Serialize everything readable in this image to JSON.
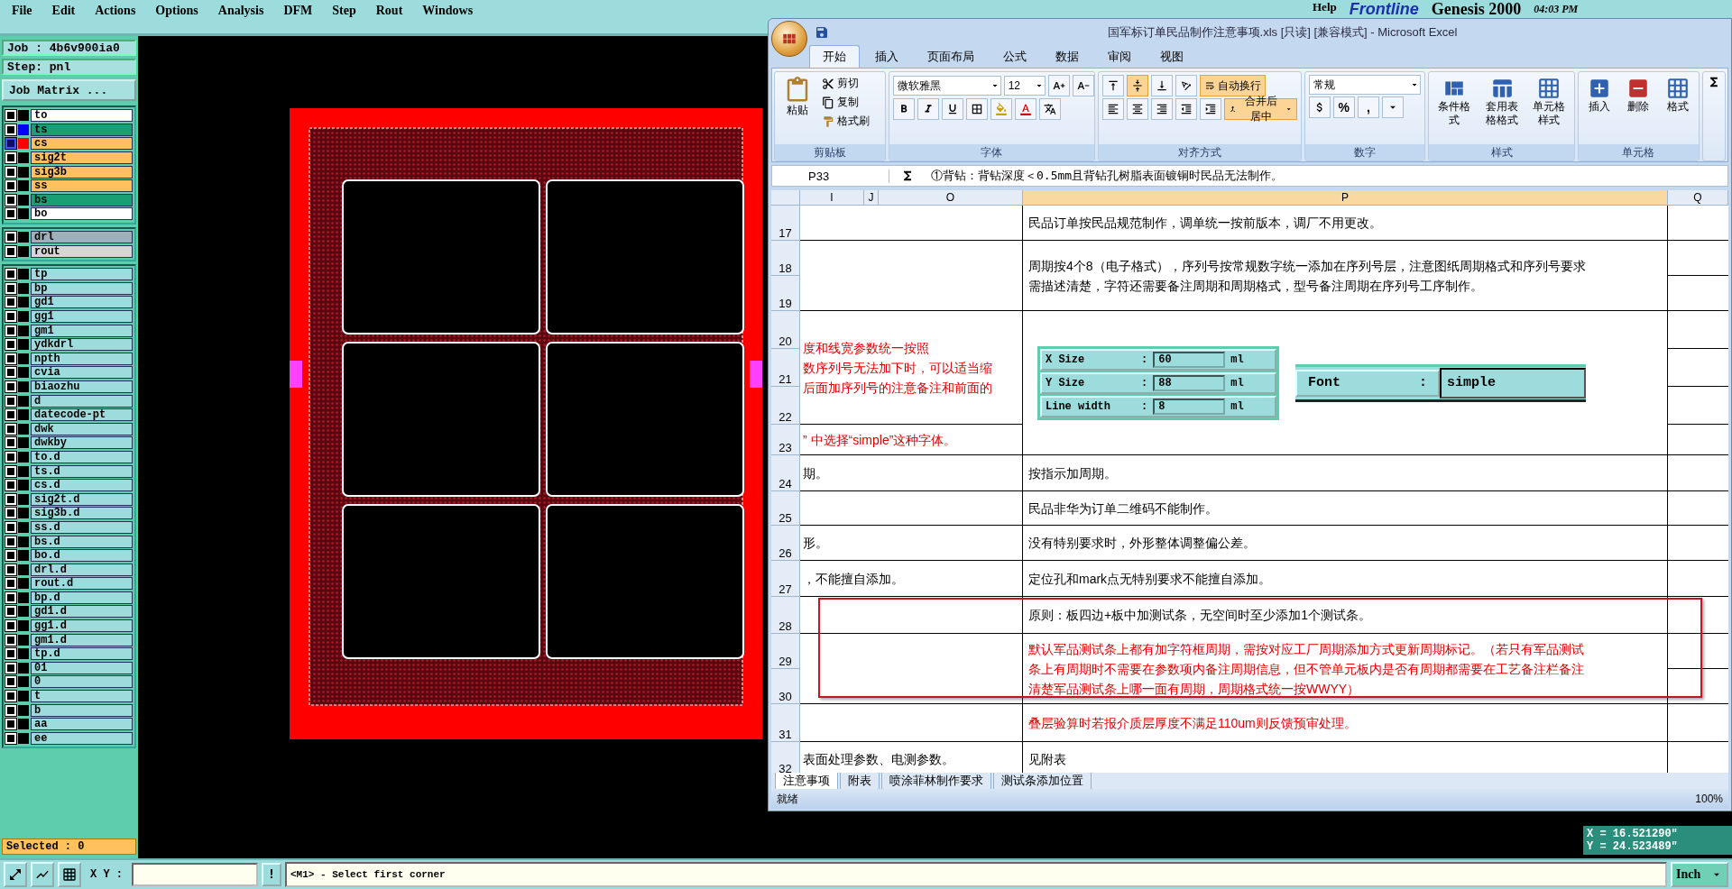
{
  "menu": [
    "File",
    "Edit",
    "Actions",
    "Options",
    "Analysis",
    "DFM",
    "Step",
    "Rout",
    "Windows"
  ],
  "header_right": {
    "help": "Help",
    "logo": "Frontline",
    "product": "Genesis 2000",
    "time": "04:03 PM"
  },
  "job": "Job : 4b6v900ia0",
  "step": "Step: pnl",
  "job_matrix_button": "Job Matrix ...",
  "layer_groups": [
    [
      {
        "name": "to",
        "color": "#ffffff",
        "checked": false
      },
      {
        "name": "ts",
        "color": "#1a9e74",
        "checked": false,
        "swatch": {
          "color": "#0000ff"
        }
      },
      {
        "name": "cs",
        "color": "#ffc15e",
        "checked": true,
        "swatch": {
          "color": "#ff0000"
        }
      },
      {
        "name": "sig2t",
        "color": "#ffc15e",
        "checked": false
      },
      {
        "name": "sig3b",
        "color": "#ffc15e",
        "checked": false
      },
      {
        "name": "ss",
        "color": "#ffc15e",
        "checked": false
      },
      {
        "name": "bs",
        "color": "#1a9e74",
        "checked": false
      },
      {
        "name": "bo",
        "color": "#ffffff",
        "checked": false
      }
    ],
    [
      {
        "name": "drl",
        "color": "#9fb0b6",
        "checked": false
      },
      {
        "name": "rout",
        "color": "#d6d6d6",
        "checked": false
      }
    ],
    [
      {
        "name": "tp",
        "color": "#9ddcdc",
        "checked": false
      },
      {
        "name": "bp",
        "color": "#9ddcdc",
        "checked": false
      },
      {
        "name": "gd1",
        "color": "#9ddcdc",
        "checked": false
      },
      {
        "name": "gg1",
        "color": "#9ddcdc",
        "checked": false
      },
      {
        "name": "gm1",
        "color": "#9ddcdc",
        "checked": false
      },
      {
        "name": "ydkdrl",
        "color": "#9ddcdc",
        "checked": false
      },
      {
        "name": "npth",
        "color": "#9ddcdc",
        "checked": false
      },
      {
        "name": "cvia",
        "color": "#9ddcdc",
        "checked": false
      },
      {
        "name": "biaozhu",
        "color": "#9ddcdc",
        "checked": false
      },
      {
        "name": "d",
        "color": "#9ddcdc",
        "checked": false
      },
      {
        "name": "datecode-pt",
        "color": "#9ddcdc",
        "checked": false
      },
      {
        "name": "dwk",
        "color": "#9ddcdc",
        "checked": false
      },
      {
        "name": "dwkby",
        "color": "#9ddcdc",
        "checked": false
      },
      {
        "name": "to.d",
        "color": "#9ddcdc",
        "checked": false
      },
      {
        "name": "ts.d",
        "color": "#9ddcdc",
        "checked": false
      },
      {
        "name": "cs.d",
        "color": "#9ddcdc",
        "checked": false
      },
      {
        "name": "sig2t.d",
        "color": "#9ddcdc",
        "checked": false
      },
      {
        "name": "sig3b.d",
        "color": "#9ddcdc",
        "checked": false
      },
      {
        "name": "ss.d",
        "color": "#9ddcdc",
        "checked": false
      },
      {
        "name": "bs.d",
        "color": "#9ddcdc",
        "checked": false
      },
      {
        "name": "bo.d",
        "color": "#9ddcdc",
        "checked": false
      },
      {
        "name": "drl.d",
        "color": "#9ddcdc",
        "checked": false
      },
      {
        "name": "rout.d",
        "color": "#9ddcdc",
        "checked": false
      },
      {
        "name": "bp.d",
        "color": "#9ddcdc",
        "checked": false
      },
      {
        "name": "gd1.d",
        "color": "#9ddcdc",
        "checked": false
      },
      {
        "name": "gg1.d",
        "color": "#9ddcdc",
        "checked": false
      },
      {
        "name": "gm1.d",
        "color": "#9ddcdc",
        "checked": false
      },
      {
        "name": "tp.d",
        "color": "#9ddcdc",
        "checked": false
      },
      {
        "name": "01",
        "color": "#9ddcdc",
        "checked": false
      },
      {
        "name": "0",
        "color": "#9ddcdc",
        "checked": false
      },
      {
        "name": "t",
        "color": "#9ddcdc",
        "checked": false
      },
      {
        "name": "b",
        "color": "#9ddcdc",
        "checked": false
      },
      {
        "name": "aa",
        "color": "#9ddcdc",
        "checked": false
      },
      {
        "name": "ee",
        "color": "#9ddcdc",
        "checked": false
      }
    ]
  ],
  "selected": "Selected : 0",
  "coordinates": [
    "X = 16.521290\"",
    "Y = 24.523489\""
  ],
  "bottom_bar": {
    "xy_label": "X Y :",
    "bang_button": "!",
    "message": "<M1> - Select first corner",
    "units_button": "Inch"
  },
  "excel": {
    "title": "国军标订单民品制作注意事项.xls  [只读]  [兼容模式] - Microsoft Excel",
    "tabs": [
      {
        "label": "开始",
        "selected": true
      },
      {
        "label": "插入",
        "selected": false
      },
      {
        "label": "页面布局",
        "selected": false
      },
      {
        "label": "公式",
        "selected": false
      },
      {
        "label": "数据",
        "selected": false
      },
      {
        "label": "审阅",
        "selected": false
      },
      {
        "label": "视图",
        "selected": false
      }
    ],
    "clipboard": {
      "paste": "粘贴",
      "cut": "剪切",
      "copy": "复制",
      "format_painter": "格式刷",
      "label": "剪贴板"
    },
    "font": {
      "name": "微软雅黑",
      "size": "12",
      "label": "字体"
    },
    "alignment": {
      "wrap_text": {
        "label": "自动换行",
        "on": true
      },
      "merge_center": {
        "label": "合并后居中",
        "on": true
      },
      "label": "对齐方式"
    },
    "number": {
      "format": "常规",
      "percent": "%",
      "comma": ",",
      "label": "数字"
    },
    "styles": {
      "items": [
        "条件格式",
        "套用表格格式",
        "单元格样式"
      ],
      "label": "样式"
    },
    "cells": {
      "items": [
        "插入",
        "删除",
        "格式"
      ],
      "label": "单元格"
    },
    "formula_bar": {
      "name_box": "P33",
      "content": "①背钻：背钻深度＜0.5mm且背钻孔树脂表面镀铜时民品无法制作。"
    },
    "columns": [
      {
        "label": "I",
        "selected": false
      },
      {
        "label": "J",
        "selected": false
      },
      {
        "label": "O",
        "selected": false
      },
      {
        "label": "P",
        "selected": true
      },
      {
        "label": "Q",
        "selected": false
      }
    ],
    "row_numbers": [
      "17",
      "18",
      "19",
      "20",
      "21",
      "22",
      "23",
      "24",
      "25",
      "26",
      "27",
      "28",
      "29",
      "30",
      "31",
      "32"
    ],
    "left_cells": [
      {
        "kind": "red",
        "lines": [
          "度和线宽参数统一按照",
          "数序列号无法加下时，可以适当缩",
          "后面加序列号的注意备注和前面的"
        ]
      },
      {
        "kind": "red",
        "lines": [
          "” 中选择“simple”这种字体。"
        ]
      },
      {
        "kind": "plain",
        "lines": [
          "期。"
        ]
      },
      {
        "kind": "plain",
        "lines": [
          "形。"
        ]
      },
      {
        "kind": "plain",
        "lines": [
          "，不能擅自添加。"
        ]
      },
      {
        "kind": "plain",
        "lines": [
          "表面处理参数、电测参数。"
        ]
      }
    ],
    "p_cells": [
      {
        "kind": "plain",
        "lines": [
          "民品订单按民品规范制作，调单统一按前版本，调厂不用更改。"
        ]
      },
      {
        "kind": "plain",
        "lines": [
          "周期按4个8（电子格式），序列号按常规数字统一添加在序列号层，注意图纸周期格式和序列号要求",
          "需描述清楚，字符还需要备注周期和周期格式，型号备注周期在序列号工序制作。"
        ]
      },
      {
        "kind": "plain",
        "lines": [
          "按指示加周期。"
        ]
      },
      {
        "kind": "plain",
        "lines": [
          "民品非华为订单二维码不能制作。"
        ]
      },
      {
        "kind": "plain",
        "lines": [
          "没有特别要求时，外形整体调整偏公差。"
        ]
      },
      {
        "kind": "plain",
        "lines": [
          "定位孔和mark点无特别要求不能擅自添加。"
        ]
      },
      {
        "kind": "plain",
        "lines": [
          "原则：板四边+板中加测试条，无空间时至少添加1个测试条。"
        ]
      },
      {
        "kind": "red",
        "lines": [
          "默认军品测试条上都有加字符框周期，需按对应工厂周期添加方式更新周期标记。（若只有军品测试",
          "条上有周期时不需要在参数项内备注周期信息，但不管单元板内是否有周期都需要在工艺备注栏备注",
          "清楚军品测试条上哪一面有周期，周期格式统一按WWYY）"
        ]
      },
      {
        "kind": "red",
        "lines": [
          "叠层验算时若报介质层厚度不满足110um则反馈预审处理。"
        ]
      },
      {
        "kind": "plain",
        "lines": [
          "见附表"
        ]
      }
    ],
    "size_fields": [
      {
        "label": "X Size",
        "sep": ":",
        "value": "60",
        "unit": "ml"
      },
      {
        "label": "Y Size",
        "sep": ":",
        "value": "88",
        "unit": "ml"
      },
      {
        "label": "Line width",
        "sep": ":",
        "value": "8",
        "unit": "ml"
      }
    ],
    "font_field": {
      "label": "Font",
      "sep": ":",
      "value": "simple"
    },
    "sheet_tabs": [
      {
        "label": "注意事项",
        "selected": true
      },
      {
        "label": "附表",
        "selected": false
      },
      {
        "label": "喷涂菲林制作要求",
        "selected": false
      },
      {
        "label": "测试条添加位置",
        "selected": false
      }
    ],
    "status": "就绪",
    "zoom": "100%"
  }
}
